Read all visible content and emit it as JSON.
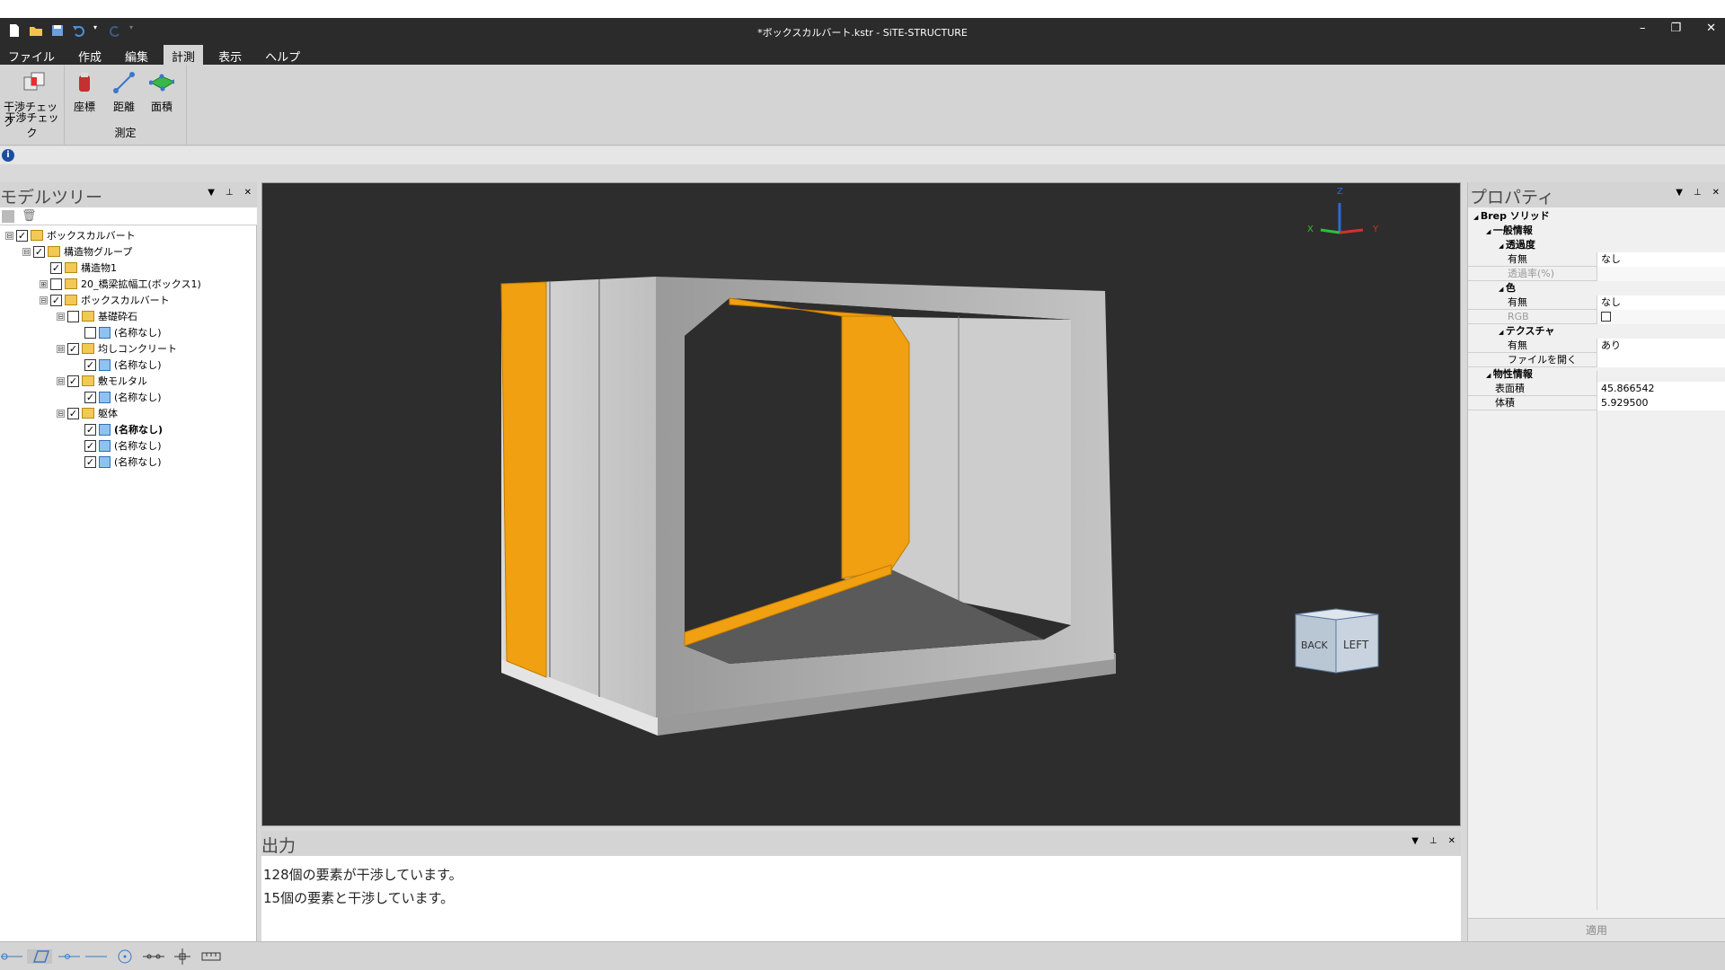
{
  "window": {
    "title": "*ボックスカルバート.kstr - SiTE-STRUCTURE",
    "controls": [
      "–",
      "❐",
      "✕"
    ]
  },
  "menu": [
    "ファイル",
    "作成",
    "編集",
    "計測",
    "表示",
    "ヘルプ"
  ],
  "ribbon": {
    "groups": [
      {
        "label": "干渉チェック",
        "buttons": [
          "干渉チェック"
        ]
      },
      {
        "label": "測定",
        "buttons": [
          "座標",
          "距離",
          "面積"
        ]
      }
    ]
  },
  "model_tree": {
    "title": "モデルツリー",
    "items": [
      {
        "label": "ボックスカルバート",
        "level": 0,
        "expander": "⊟",
        "checked": true,
        "type": "folder"
      },
      {
        "label": "構造物グループ",
        "level": 1,
        "expander": "⊟",
        "checked": true,
        "type": "folder"
      },
      {
        "label": "構造物1",
        "level": 2,
        "expander": "",
        "checked": true,
        "type": "folder"
      },
      {
        "label": "20_橋梁拡幅工(ボックス1)",
        "level": 2,
        "expander": "⊞",
        "checked": false,
        "type": "folder"
      },
      {
        "label": "ボックスカルバート",
        "level": 2,
        "expander": "⊟",
        "checked": true,
        "type": "folder"
      },
      {
        "label": "基礎砕石",
        "level": 3,
        "expander": "⊟",
        "checked": false,
        "type": "folder"
      },
      {
        "label": "(名称なし)",
        "level": 4,
        "expander": "",
        "checked": false,
        "type": "solid"
      },
      {
        "label": "均しコンクリート",
        "level": 3,
        "expander": "⊟",
        "checked": true,
        "type": "folder"
      },
      {
        "label": "(名称なし)",
        "level": 4,
        "expander": "",
        "checked": true,
        "type": "solid"
      },
      {
        "label": "敷モルタル",
        "level": 3,
        "expander": "⊟",
        "checked": true,
        "type": "folder"
      },
      {
        "label": "(名称なし)",
        "level": 4,
        "expander": "",
        "checked": true,
        "type": "solid"
      },
      {
        "label": "躯体",
        "level": 3,
        "expander": "⊟",
        "checked": true,
        "type": "folder"
      },
      {
        "label": "(名称なし)",
        "level": 4,
        "expander": "",
        "checked": true,
        "type": "solid",
        "bold": true
      },
      {
        "label": "(名称なし)",
        "level": 4,
        "expander": "",
        "checked": true,
        "type": "solid"
      },
      {
        "label": "(名称なし)",
        "level": 4,
        "expander": "",
        "checked": true,
        "type": "solid"
      }
    ]
  },
  "viewport": {
    "axes": {
      "z": "Z",
      "y": "Y",
      "x": "X"
    },
    "view_cube": {
      "back": "BACK",
      "left": "LEFT"
    },
    "highlight_color": "#f0a010"
  },
  "output": {
    "title": "出力",
    "lines": [
      "128個の要素が干渉しています。",
      "15個の要素と干渉しています。"
    ]
  },
  "properties": {
    "title": "プロパティ",
    "rows": [
      {
        "key": "Brep ソリッド",
        "level": 0,
        "header": true
      },
      {
        "key": "一般情報",
        "level": 1,
        "header": true
      },
      {
        "key": "透過度",
        "level": 2,
        "header": true
      },
      {
        "key": "有無",
        "level": 3,
        "value": "なし"
      },
      {
        "key": "透過率(%)",
        "level": 3,
        "value": "",
        "disabled": true
      },
      {
        "key": "色",
        "level": 2,
        "header": true
      },
      {
        "key": "有無",
        "level": 3,
        "value": "なし"
      },
      {
        "key": "RGB",
        "level": 3,
        "value": "",
        "disabled": true,
        "checkbox": true
      },
      {
        "key": "テクスチャ",
        "level": 2,
        "header": true
      },
      {
        "key": "有無",
        "level": 3,
        "value": "あり"
      },
      {
        "key": "ファイルを開く",
        "level": 3,
        "value": ""
      },
      {
        "key": "物性情報",
        "level": 1,
        "header": true
      },
      {
        "key": "表面積",
        "level": 2,
        "value": "45.866542"
      },
      {
        "key": "体積",
        "level": 2,
        "value": "5.929500"
      }
    ],
    "apply": "適用"
  },
  "statusbar": {
    "icons": [
      "line-snap-icon",
      "plane-snap-icon",
      "point-line-icon",
      "line-icon",
      "center-snap-icon",
      "midpoint-icon",
      "move-icon",
      "ruler-icon"
    ]
  }
}
